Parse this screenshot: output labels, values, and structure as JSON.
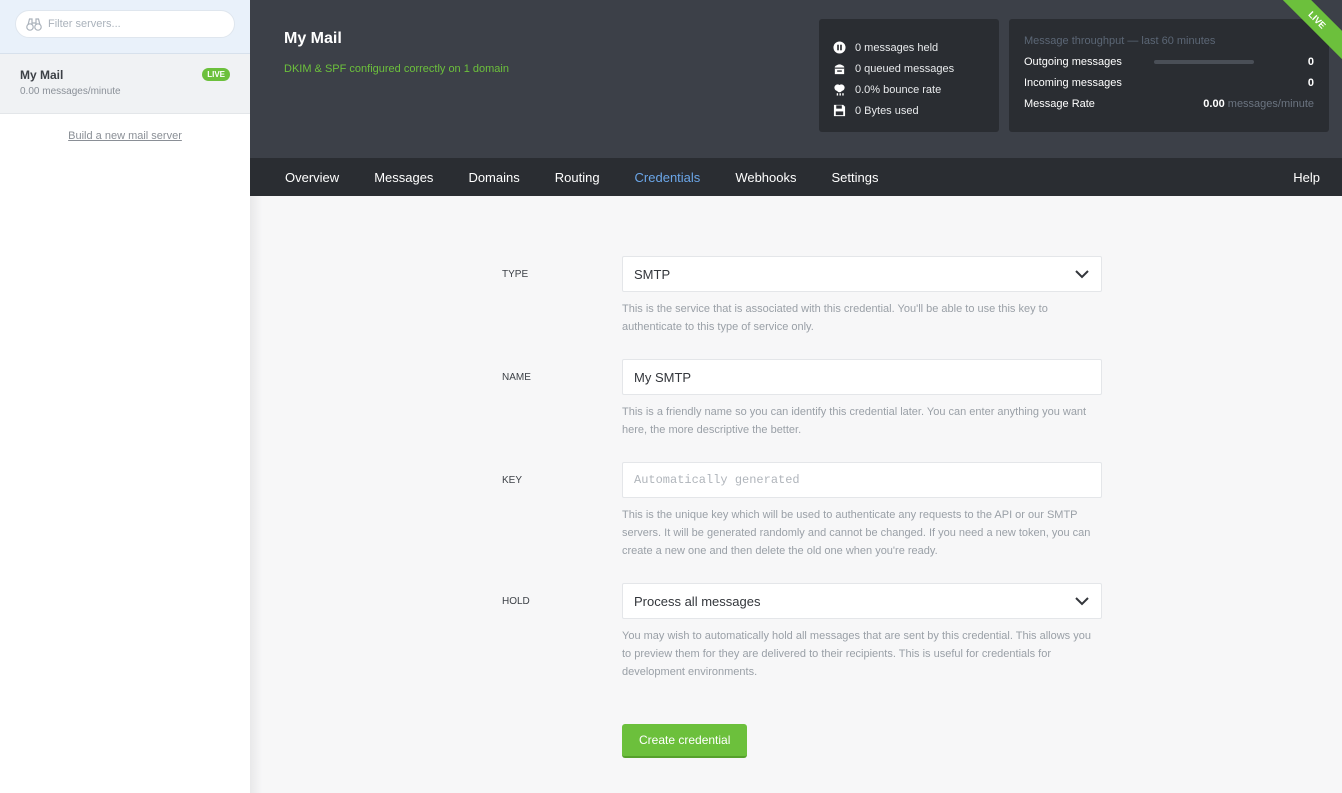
{
  "sidebar": {
    "filter_placeholder": "Filter servers...",
    "servers": [
      {
        "name": "My Mail",
        "rate": "0.00 messages/minute",
        "badge": "LIVE"
      }
    ],
    "build_link": "Build a new mail server"
  },
  "header": {
    "title": "My Mail",
    "subtitle": "DKIM & SPF configured correctly on 1 domain",
    "ribbon": "LIVE",
    "stats": [
      {
        "icon": "pause-icon",
        "text": "0 messages held"
      },
      {
        "icon": "inbox-icon",
        "text": "0 queued messages"
      },
      {
        "icon": "bounce-icon",
        "text": "0.0% bounce rate"
      },
      {
        "icon": "disk-icon",
        "text": "0 Bytes used"
      }
    ],
    "throughput": {
      "title": "Message throughput — last 60 minutes",
      "outgoing_label": "Outgoing messages",
      "outgoing_value": "0",
      "outgoing_fraction": 0,
      "incoming_label": "Incoming messages",
      "incoming_value": "0",
      "rate_label": "Message Rate",
      "rate_value": "0.00",
      "rate_unit": "messages/minute"
    }
  },
  "nav": {
    "tabs": [
      "Overview",
      "Messages",
      "Domains",
      "Routing",
      "Credentials",
      "Webhooks",
      "Settings"
    ],
    "active": "Credentials",
    "help": "Help"
  },
  "form": {
    "type": {
      "label": "TYPE",
      "value": "SMTP",
      "help": "This is the service that is associated with this credential. You'll be able to use this key to authenticate to this type of service only."
    },
    "name": {
      "label": "NAME",
      "value": "My SMTP",
      "help": "This is a friendly name so you can identify this credential later. You can enter anything you want here, the more descriptive the better."
    },
    "key": {
      "label": "KEY",
      "placeholder": "Automatically generated",
      "help": "This is the unique key which will be used to authenticate any requests to the API or our SMTP servers. It will be generated randomly and cannot be changed. If you need a new token, you can create a new one and then delete the old one when you're ready."
    },
    "hold": {
      "label": "HOLD",
      "value": "Process all messages",
      "help": "You may wish to automatically hold all messages that are sent by this credential. This allows you to preview them for they are delivered to their recipients. This is useful for credentials for development environments."
    },
    "submit": "Create credential"
  },
  "colors": {
    "accent_green": "#6cc03c",
    "active_tab": "#6ba6e8",
    "header_bg": "#3c4048",
    "nav_bg": "#2a2d32"
  }
}
